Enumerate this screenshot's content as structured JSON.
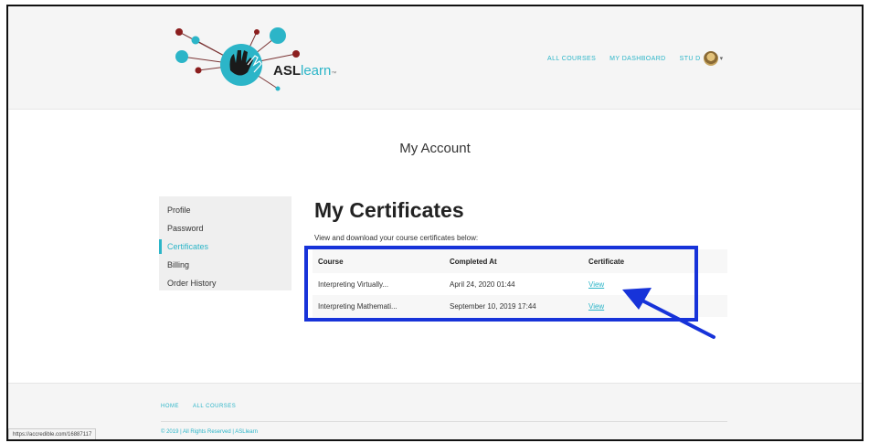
{
  "brand": {
    "logo_bold": "ASL",
    "logo_light": "learn",
    "logo_tm": "™",
    "accent_color": "#2cb5c8",
    "highlight_color": "#1733d9"
  },
  "topnav": {
    "all_courses": "ALL COURSES",
    "my_dashboard": "MY DASHBOARD",
    "user_name": "STU D",
    "caret": "▾"
  },
  "page": {
    "title": "My Account"
  },
  "sidemenu": {
    "items": [
      {
        "label": "Profile"
      },
      {
        "label": "Password"
      },
      {
        "label": "Certificates"
      },
      {
        "label": "Billing"
      },
      {
        "label": "Order History"
      }
    ]
  },
  "certificates": {
    "title": "My Certificates",
    "subtitle": "View and download your course certificates below:",
    "headers": {
      "course": "Course",
      "completed": "Completed At",
      "certificate": "Certificate"
    },
    "rows": [
      {
        "course": "Interpreting Virtually...",
        "completed": "April 24, 2020 01:44",
        "link": "View"
      },
      {
        "course": "Interpreting Mathemati...",
        "completed": "September 10, 2019 17:44",
        "link": "View"
      }
    ]
  },
  "footer": {
    "home": "HOME",
    "all_courses": "ALL COURSES",
    "copyright": "© 2019 | All Rights Reserved | ASLlearn"
  },
  "status_bar": {
    "url": "https://accredible.com/16887117"
  }
}
